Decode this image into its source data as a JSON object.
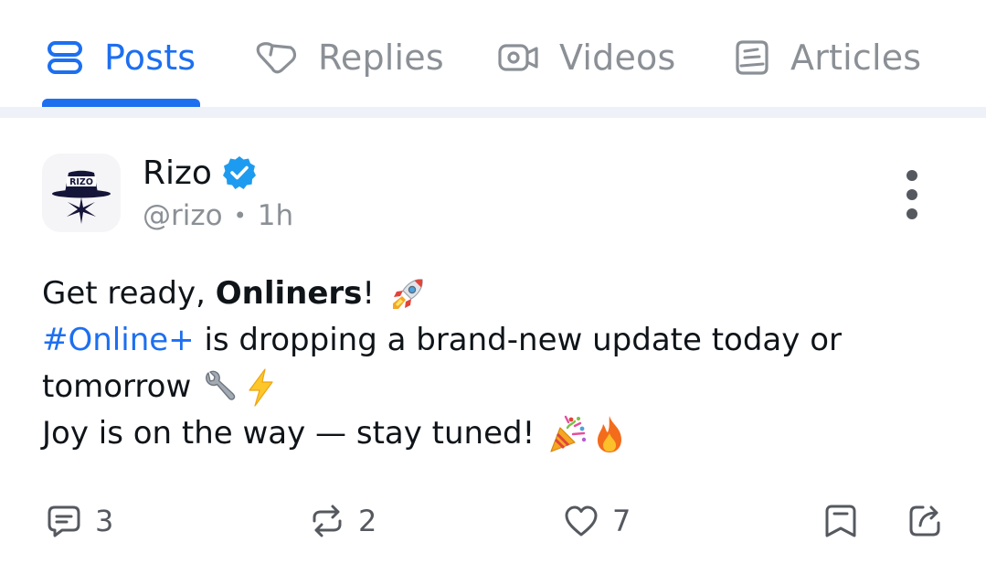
{
  "tabs": [
    {
      "label": "Posts",
      "icon": "posts-icon",
      "active": true
    },
    {
      "label": "Replies",
      "icon": "replies-icon",
      "active": false
    },
    {
      "label": "Videos",
      "icon": "videos-icon",
      "active": false
    },
    {
      "label": "Articles",
      "icon": "articles-icon",
      "active": false
    }
  ],
  "post": {
    "avatar_text": "RIZO",
    "author_name": "Rizo",
    "verified_icon": "verified-badge-icon",
    "handle": "@rizo",
    "separator": "•",
    "time": "1h",
    "lines": {
      "line1_a": "Get ready, ",
      "line1_bold": "Onliners",
      "line1_b": "!",
      "line2_hashtag": "#Online+",
      "line2_rest": " is dropping a brand-new update today or",
      "line3": "tomorrow",
      "line4": "Joy is on the way — stay tuned!"
    },
    "emojis": [
      "rocket-emoji",
      "wrench-emoji",
      "lightning-emoji",
      "party-popper-emoji",
      "fire-emoji"
    ]
  },
  "actions": {
    "comments": "3",
    "reposts": "2",
    "likes": "7"
  },
  "colors": {
    "accent": "#1d6ff0",
    "muted": "#8b9096",
    "icon": "#55595f",
    "verified": "#1d9bf0"
  }
}
